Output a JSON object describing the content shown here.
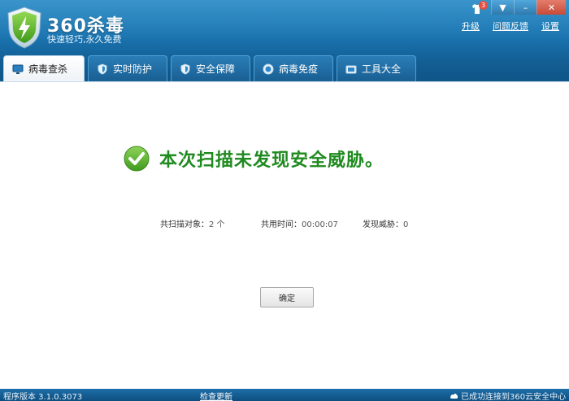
{
  "app": {
    "title": "360杀毒",
    "slogan": "快速轻巧,永久免费"
  },
  "window": {
    "notify_count": "3",
    "minimize_label": "–",
    "menu_label": "▼",
    "close_label": "✕"
  },
  "top_links": {
    "upgrade": "升级",
    "feedback": "问题反馈",
    "settings": "设置"
  },
  "tabs": [
    {
      "label": "病毒查杀",
      "icon": "monitor-icon",
      "active": true
    },
    {
      "label": "实时防护",
      "icon": "shield-icon",
      "active": false
    },
    {
      "label": "安全保障",
      "icon": "shield-icon",
      "active": false
    },
    {
      "label": "病毒免疫",
      "icon": "globe-icon",
      "active": false
    },
    {
      "label": "工具大全",
      "icon": "toolbox-icon",
      "active": false
    }
  ],
  "result": {
    "message": "本次扫描未发现安全威胁。",
    "icon": "check-circle-icon"
  },
  "stats": {
    "objects_label": "共扫描对象：",
    "objects_value": "2 个",
    "time_label": "共用时间：",
    "time_value": "00:00:07",
    "threats_label": "发现威胁：",
    "threats_value": "0"
  },
  "buttons": {
    "ok": "确定"
  },
  "statusbar": {
    "version": "程序版本 3.1.0.3073",
    "check_update": "检查更新",
    "connected": "已成功连接到360云安全中心"
  },
  "colors": {
    "header": "#1a74b0",
    "success_text": "#1f8a1f",
    "check_green": "#4caf28"
  }
}
